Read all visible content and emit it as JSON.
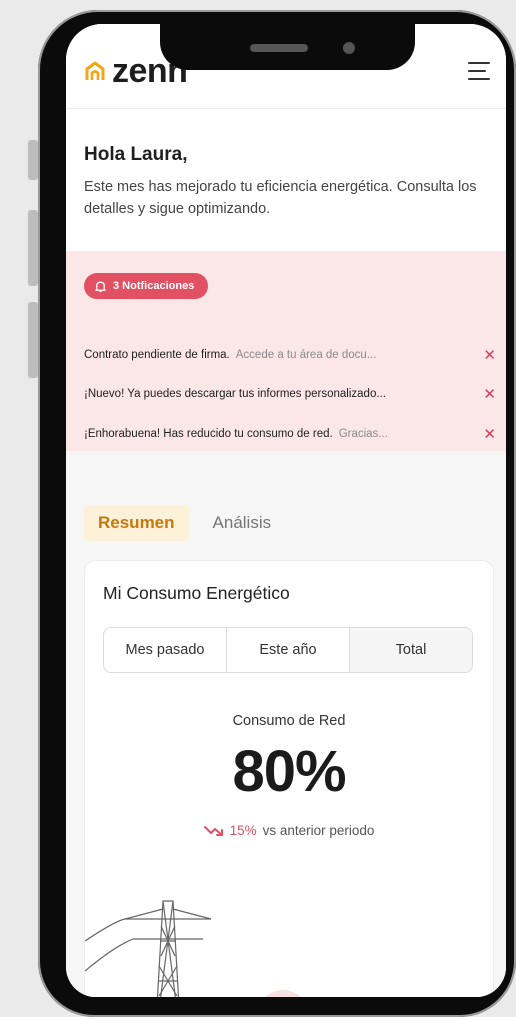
{
  "app": {
    "logo_text": "zenn"
  },
  "greeting": {
    "title": "Hola Laura,",
    "message": "Este mes has mejorado tu eficiencia energética. Consulta los detalles y sigue optimizando."
  },
  "notifications": {
    "badge_label": "3 Notficaciones",
    "items": [
      {
        "title": "Contrato pendiente de firma.",
        "detail": "Accede a tu área de docu..."
      },
      {
        "title": "¡Nuevo! Ya puedes descargar tus informes personalizado...",
        "detail": ""
      },
      {
        "title": "¡Enhorabuena! Has reducido tu consumo de red.",
        "detail": "Gracias..."
      }
    ]
  },
  "tabs": [
    {
      "label": "Resumen",
      "active": true
    },
    {
      "label": "Análisis",
      "active": false
    }
  ],
  "consumption_card": {
    "title": "Mi Consumo Energético",
    "periods": [
      "Mes pasado",
      "Este año",
      "Total"
    ],
    "selected_period": "Total",
    "metric_label": "Consumo de Red",
    "metric_value": "80%",
    "trend_percent": "15%",
    "trend_text": "vs anterior periodo"
  },
  "colors": {
    "brand_accent": "#f2a516",
    "notification_red": "#e25063",
    "notification_bg": "#fbe6e8",
    "tab_active_bg": "#fdf1d9",
    "tab_active_text": "#c2790f"
  },
  "icons": [
    "house-logo-icon",
    "hamburger-menu-icon",
    "bell-icon",
    "close-icon",
    "trend-down-icon",
    "lightning-icon"
  ]
}
